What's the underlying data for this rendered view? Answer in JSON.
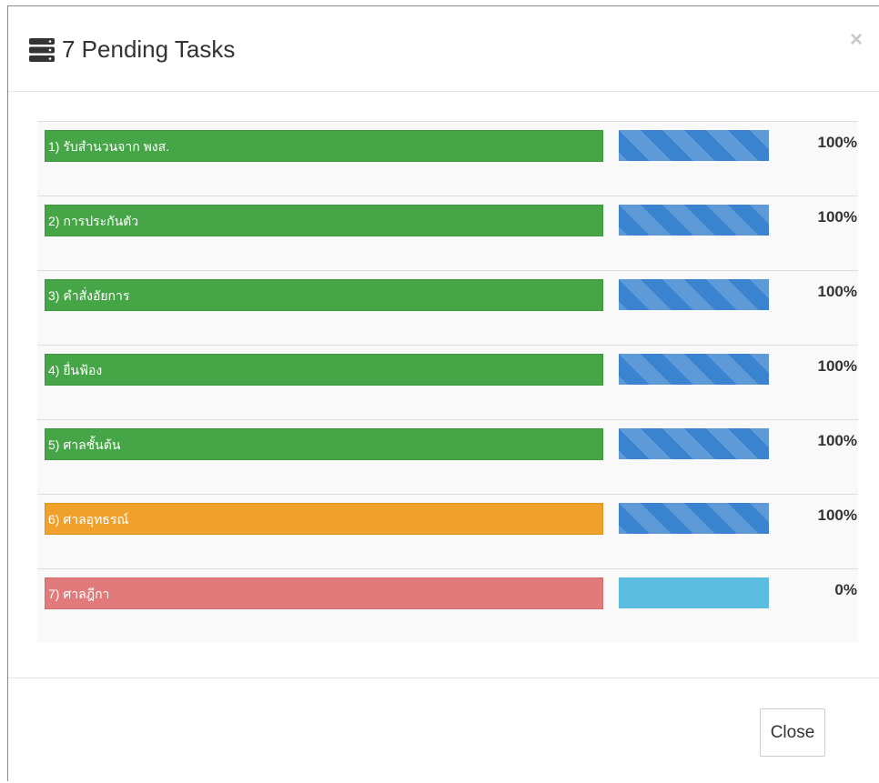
{
  "modal": {
    "title": "7 Pending Tasks",
    "close_glyph": "×",
    "header_icon": "server-stack-icon",
    "footer": {
      "close_label": "Close"
    }
  },
  "colors": {
    "success": "#46a546",
    "warning": "#efa12b",
    "danger": "#e17a7a",
    "progress": "#3a83cf",
    "progress_empty": "#5bbde0"
  },
  "tasks": [
    {
      "label": "1) รับสำนวนจาก พงส.",
      "status": "success",
      "progress": 100,
      "percent_text": "100%"
    },
    {
      "label": "2) การประกันตัว",
      "status": "success",
      "progress": 100,
      "percent_text": "100%"
    },
    {
      "label": "3) คำสั่งอัยการ",
      "status": "success",
      "progress": 100,
      "percent_text": "100%"
    },
    {
      "label": "4) ยื่นฟ้อง",
      "status": "success",
      "progress": 100,
      "percent_text": "100%"
    },
    {
      "label": "5) ศาลชั้นต้น",
      "status": "success",
      "progress": 100,
      "percent_text": "100%"
    },
    {
      "label": "6) ศาลอุทธรณ์",
      "status": "warning",
      "progress": 100,
      "percent_text": "100%"
    },
    {
      "label": "7) ศาลฎีกา",
      "status": "danger",
      "progress": 0,
      "percent_text": "0%"
    }
  ]
}
